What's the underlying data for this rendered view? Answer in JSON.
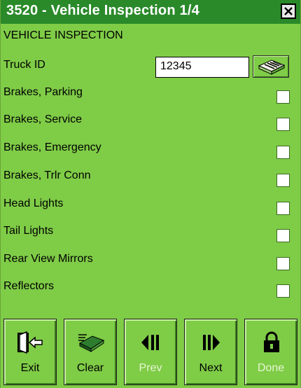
{
  "window": {
    "title": "3520 - Vehicle Inspection 1/4",
    "close_symbol": "X"
  },
  "form": {
    "section_heading": "VEHICLE INSPECTION",
    "truck_id": {
      "label": "Truck ID",
      "value": "12345",
      "scan_icon": "barcode-scanner-icon"
    },
    "items": [
      {
        "label": "Brakes, Parking",
        "checked": false
      },
      {
        "label": "Brakes, Service",
        "checked": false
      },
      {
        "label": "Brakes, Emergency",
        "checked": false
      },
      {
        "label": "Brakes, Trlr Conn",
        "checked": false
      },
      {
        "label": "Head Lights",
        "checked": false
      },
      {
        "label": "Tail Lights",
        "checked": false
      },
      {
        "label": "Rear View Mirrors",
        "checked": false
      },
      {
        "label": "Reflectors",
        "checked": false
      }
    ]
  },
  "toolbar": {
    "exit": {
      "label": "Exit",
      "icon": "exit-door-icon",
      "enabled": true
    },
    "clear": {
      "label": "Clear",
      "icon": "eraser-icon",
      "enabled": true
    },
    "prev": {
      "label": "Prev",
      "icon": "prev-arrow-icon",
      "enabled": false
    },
    "next": {
      "label": "Next",
      "icon": "next-arrow-icon",
      "enabled": true
    },
    "done": {
      "label": "Done",
      "icon": "lock-icon",
      "enabled": false
    }
  },
  "colors": {
    "background": "#7fcc47",
    "titlebar": "#2a8a2a",
    "disabled_text": "#e6f5d2"
  }
}
